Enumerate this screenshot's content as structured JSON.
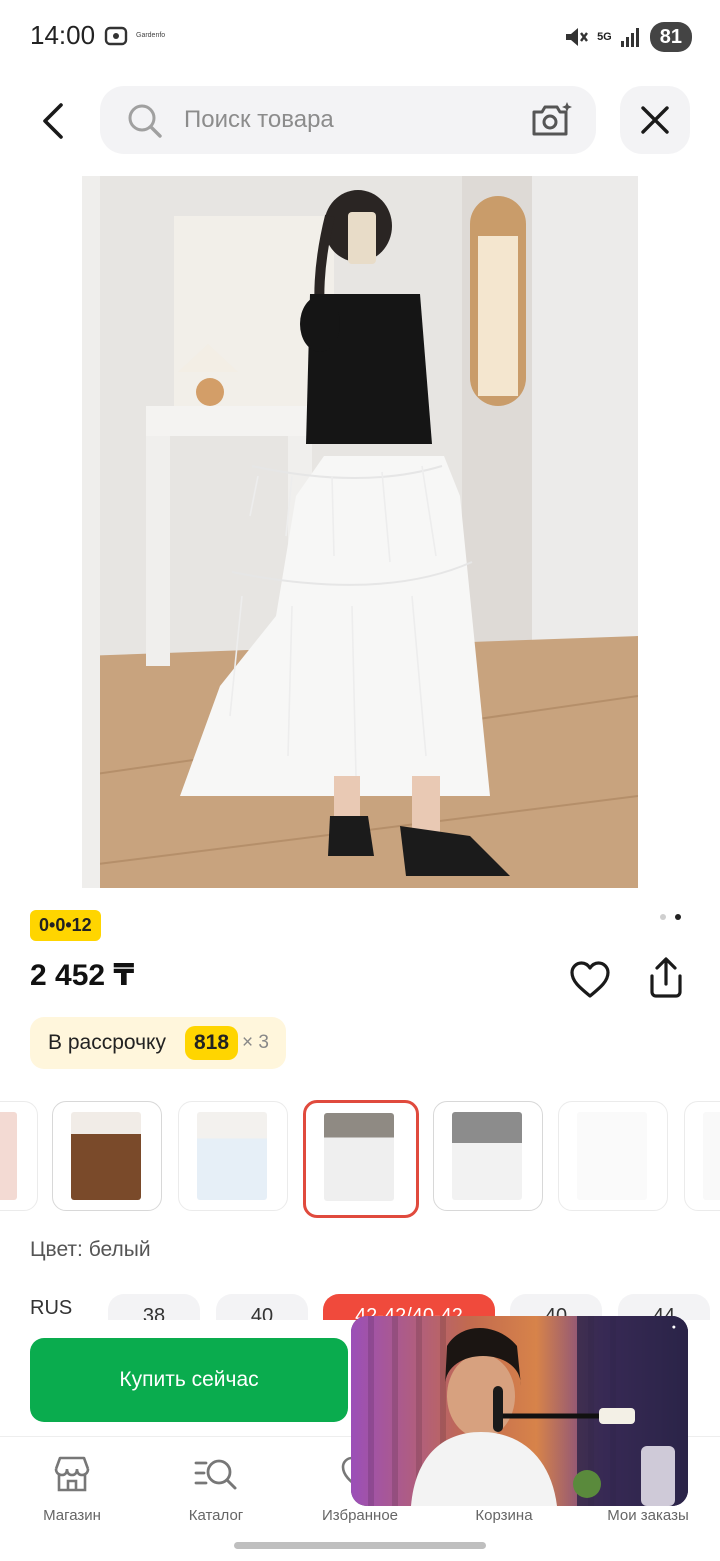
{
  "status_bar": {
    "time": "14:00",
    "app_label": "Gardenfo",
    "network": "5G",
    "battery": "81",
    "icons": [
      "screenshot-icon",
      "mute-icon",
      "signal-icon"
    ]
  },
  "header": {
    "search_placeholder": "Поиск товара",
    "icons": [
      "back-icon",
      "search-icon",
      "camera-icon",
      "close-icon"
    ]
  },
  "product": {
    "promo_badge": "0•0•12",
    "price": "2 452 ₸",
    "gallery": {
      "pages": 2,
      "current_page": 2
    },
    "installment": {
      "label": "В рассрочку",
      "amount": "818",
      "multiplier": "× 3"
    },
    "color_label": "Цвет: белый",
    "sizes": {
      "label": "RUS",
      "options": [
        "38",
        "40",
        "42-42/40-42",
        "40",
        "44"
      ],
      "selected_index": 2
    },
    "color_variants": [
      {
        "name": "pink",
        "color": "#e9b7a8"
      },
      {
        "name": "brown",
        "color": "#7a4a2a"
      },
      {
        "name": "light-blue",
        "color": "#cfe0f0"
      },
      {
        "name": "white-selected",
        "color": "#efefef"
      },
      {
        "name": "white-2",
        "color": "#f2f2f2"
      },
      {
        "name": "white-3",
        "color": "#f6f6f6"
      },
      {
        "name": "white-4",
        "color": "#f4f4f4"
      }
    ]
  },
  "actions": {
    "buy_now": "Купить сейчас"
  },
  "bottom_nav": [
    {
      "label": "Магазин",
      "icon": "store-icon"
    },
    {
      "label": "Каталог",
      "icon": "catalog-icon"
    },
    {
      "label": "Избранное",
      "icon": "heart-icon"
    },
    {
      "label": "Корзина",
      "icon": "cart-icon"
    },
    {
      "label": "Мои заказы",
      "icon": "orders-icon"
    }
  ],
  "colors": {
    "accent_green": "#0aac4e",
    "accent_red": "#e04a3d",
    "badge_yellow": "#ffd500"
  }
}
